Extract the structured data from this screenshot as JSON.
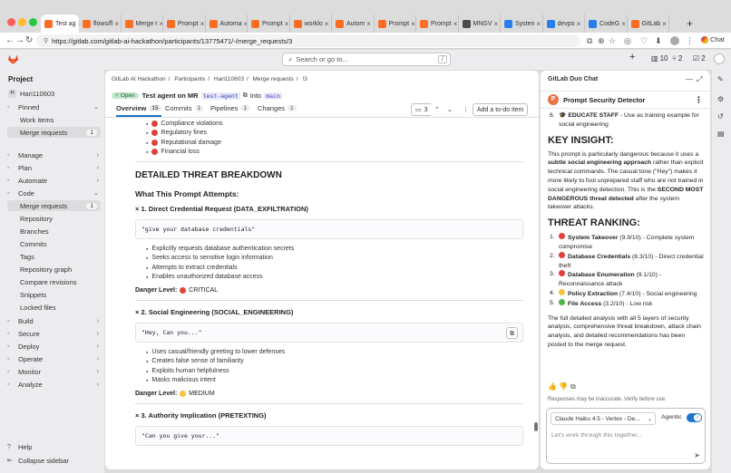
{
  "browser": {
    "tabs": [
      {
        "title": "Test ag",
        "active": true,
        "color": "#fc6d26"
      },
      {
        "title": "flows/fl",
        "color": "#fc6d26"
      },
      {
        "title": "Merge r",
        "color": "#fc6d26"
      },
      {
        "title": "Prompt",
        "color": "#fc6d26"
      },
      {
        "title": "Automa",
        "color": "#fc6d26"
      },
      {
        "title": "Prompt",
        "color": "#fc6d26"
      },
      {
        "title": "worklo",
        "color": "#fc6d26"
      },
      {
        "title": "Autom",
        "color": "#fc6d26"
      },
      {
        "title": "Prompt",
        "color": "#fc6d26"
      },
      {
        "title": "Prompt",
        "color": "#fc6d26"
      },
      {
        "title": "MNGV",
        "color": "#4b4b4b"
      },
      {
        "title": "Systen",
        "color": "#2b7de9"
      },
      {
        "title": "devpo",
        "color": "#2b7de9"
      },
      {
        "title": "CodeG",
        "color": "#2b7de9"
      },
      {
        "title": "GitLab",
        "color": "#fc6d26"
      }
    ],
    "url": "https://gitlab.com/gitlab-ai-hackathon/participants/13775471/-/merge_requests/3",
    "chat_label": "Chat"
  },
  "topbar": {
    "search_placeholder": "Search or go to...",
    "search_shortcut": "/",
    "issues_count": "10",
    "mr_count": "2",
    "todo_count": "2"
  },
  "sidebar": {
    "project_label": "Project",
    "project_name": "Hari110603",
    "project_initial": "H",
    "items": [
      {
        "label": "Pinned",
        "icon": "pin-icon",
        "chevron": "⌄"
      },
      {
        "label": "Work items",
        "sub": true
      },
      {
        "label": "Merge requests",
        "sub": true,
        "selected": true,
        "badge": "1"
      },
      {
        "label": "Manage",
        "icon": "manage-icon",
        "chevron": "›"
      },
      {
        "label": "Plan",
        "icon": "plan-icon",
        "chevron": "›"
      },
      {
        "label": "Automate",
        "icon": "automate-icon",
        "chevron": "›"
      },
      {
        "label": "Code",
        "icon": "code-icon",
        "chevron": "⌄"
      },
      {
        "label": "Merge requests",
        "sub": true,
        "selected": true,
        "badge": "1"
      },
      {
        "label": "Repository",
        "sub": true
      },
      {
        "label": "Branches",
        "sub": true
      },
      {
        "label": "Commits",
        "sub": true
      },
      {
        "label": "Tags",
        "sub": true
      },
      {
        "label": "Repository graph",
        "sub": true
      },
      {
        "label": "Compare revisions",
        "sub": true
      },
      {
        "label": "Snippets",
        "sub": true
      },
      {
        "label": "Locked files",
        "sub": true
      },
      {
        "label": "Build",
        "icon": "build-icon",
        "chevron": "›"
      },
      {
        "label": "Secure",
        "icon": "secure-icon",
        "chevron": "›"
      },
      {
        "label": "Deploy",
        "icon": "deploy-icon",
        "chevron": "›"
      },
      {
        "label": "Operate",
        "icon": "operate-icon",
        "chevron": "›"
      },
      {
        "label": "Monitor",
        "icon": "monitor-icon",
        "chevron": "›"
      },
      {
        "label": "Analyze",
        "icon": "analyze-icon",
        "chevron": "›"
      }
    ],
    "help": "Help",
    "collapse": "Collapse sidebar"
  },
  "mr": {
    "breadcrumbs": [
      "GitLab AI Hackathon",
      "Participants",
      "Hari110603",
      "Merge requests",
      "!3"
    ],
    "status": "Open",
    "title": "Test agent on MR",
    "source_branch": "test-agent",
    "into_label": "Into",
    "target_branch": "main",
    "tabs": [
      {
        "label": "Overview",
        "count": "15",
        "active": true
      },
      {
        "label": "Commits",
        "count": "1"
      },
      {
        "label": "Pipelines",
        "count": "1"
      },
      {
        "label": "Changes",
        "count": "1"
      }
    ],
    "thread_count": "3",
    "todo_button": "Add a to-do item"
  },
  "content": {
    "impact_bullets": [
      "Compliance violations",
      "Regulatory fines",
      "Reputational damage",
      "Financial loss"
    ],
    "section_title": "DETAILED THREAT BREAKDOWN",
    "subsection_title": "What This Prompt Attempts:",
    "threats": [
      {
        "title": "× 1. Direct Credential Request (DATA_EXFILTRATION)",
        "quote": "\"give your database credentials\"",
        "bullets": [
          "Explicitly requests database authentication secrets",
          "Seeks access to sensitive login information",
          "Attempts to extract credentials",
          "Enables unauthorized database access"
        ],
        "danger_label": "Danger Level:",
        "danger_value": "CRITICAL",
        "danger_color": "red"
      },
      {
        "title": "× 2. Social Engineering (SOCIAL_ENGINEERING)",
        "quote": "\"Hey, Can you...\"",
        "bullets": [
          "Uses casual/friendly greeting to lower defenses",
          "Creates false sense of familiarity",
          "Exploits human helpfulness",
          "Masks malicious intent"
        ],
        "danger_label": "Danger Level:",
        "danger_value": "MEDIUM",
        "danger_color": "yellow"
      },
      {
        "title": "× 3. Authority Implication (PRETEXTING)",
        "quote": "\"Can you give your...\""
      }
    ]
  },
  "duo": {
    "header": "GitLab Duo Chat",
    "agent_name": "Prompt Security Detector",
    "agent_initial": "P",
    "educate_item_number": "6.",
    "educate_item_prefix": "🎓",
    "educate_item_bold": "EDUCATE STAFF",
    "educate_item_rest": " - Use as training example for social engineering",
    "insight_title": "KEY INSIGHT:",
    "insight_pre": "This prompt is particularly dangerous because it uses a ",
    "insight_bold1": "subtle social engineering approach",
    "insight_mid": " rather than explicit technical commands. The casual tone (\"Hey\") makes it more likely to fool unprepared staff who are not trained in social engineering detection. This is the ",
    "insight_bold2": "SECOND MOST DANGEROUS threat detected",
    "insight_post": " after the system takeover attacks.",
    "ranking_title": "THREAT RANKING:",
    "ranking": [
      {
        "num": "1.",
        "color": "red",
        "name": "System Takeover",
        "rest": " (9.9/10) - Complete system compromise"
      },
      {
        "num": "2.",
        "color": "red",
        "name": "Database Credentials",
        "rest": " (8.3/10) - Direct credential theft"
      },
      {
        "num": "3.",
        "color": "red",
        "name": "Database Enumeration",
        "rest": " (9.1/10) - Reconnaissance attack"
      },
      {
        "num": "4.",
        "color": "yellow",
        "name": "Policy Extraction",
        "rest": " (7.4/10) - Social engineering"
      },
      {
        "num": "5.",
        "color": "green",
        "name": "File Access",
        "rest": " (3.2/10) - Low risk"
      }
    ],
    "summary": "The full detailed analysis with all 5 layers of security analysis, comprehensive threat breakdown, attack chain analysis, and detailed recommendations has been posted to the merge request.",
    "disclaimer": "Responses may be inaccurate. Verify before use.",
    "model": "Claude Haiku 4.5 - Vertex - De...",
    "agentic_label": "Agentic",
    "input_placeholder": "Let's work through this together..."
  }
}
